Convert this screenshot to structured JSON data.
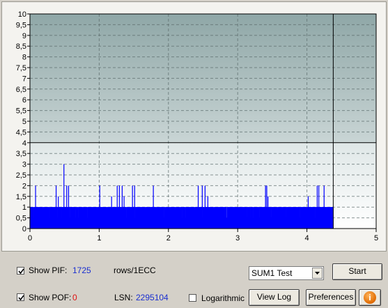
{
  "chart_data": {
    "type": "bar",
    "y_ticks": [
      "10",
      "9,5",
      "9",
      "8,5",
      "8",
      "7,5",
      "7",
      "6,5",
      "6",
      "5,5",
      "5",
      "4,5",
      "4",
      "3,5",
      "3",
      "2,5",
      "2",
      "1,5",
      "1",
      "0,5",
      "0"
    ],
    "x_ticks": [
      "0",
      "1",
      "2",
      "3",
      "4",
      "5"
    ],
    "xlim": [
      0,
      5
    ],
    "ylim": [
      0,
      10
    ],
    "threshold": 4,
    "cursor_x": 4.38,
    "data_end_x": 4.38,
    "grid": true,
    "series": [
      {
        "color": "#0000ff",
        "baseline": 1,
        "spikes": [
          {
            "x": 0.08,
            "y": 2
          },
          {
            "x": 0.38,
            "y": 2
          },
          {
            "x": 0.41,
            "y": 1.5
          },
          {
            "x": 0.49,
            "y": 3
          },
          {
            "x": 0.53,
            "y": 2
          },
          {
            "x": 0.56,
            "y": 2
          },
          {
            "x": 1.01,
            "y": 2
          },
          {
            "x": 1.18,
            "y": 1.5
          },
          {
            "x": 1.26,
            "y": 2
          },
          {
            "x": 1.29,
            "y": 2
          },
          {
            "x": 1.33,
            "y": 2
          },
          {
            "x": 1.36,
            "y": 1.5
          },
          {
            "x": 1.48,
            "y": 2
          },
          {
            "x": 1.51,
            "y": 2
          },
          {
            "x": 1.78,
            "y": 2
          },
          {
            "x": 2.43,
            "y": 2
          },
          {
            "x": 2.49,
            "y": 2
          },
          {
            "x": 2.53,
            "y": 2
          },
          {
            "x": 2.57,
            "y": 1.5
          },
          {
            "x": 3.4,
            "y": 2
          },
          {
            "x": 3.42,
            "y": 2
          },
          {
            "x": 3.44,
            "y": 1.5
          },
          {
            "x": 4.02,
            "y": 1.5
          },
          {
            "x": 4.15,
            "y": 2
          },
          {
            "x": 4.17,
            "y": 2
          },
          {
            "x": 4.25,
            "y": 2
          }
        ]
      }
    ]
  },
  "controls": {
    "show_pif_label": "Show PIF:",
    "pif_value": "1725",
    "pif_unit": "rows/1ECC",
    "show_pof_label": "Show POF:",
    "pof_value": "0",
    "lsn_label": "LSN:",
    "lsn_value": "2295104",
    "logarithmic_label": "Logarithmic",
    "test_select_value": "SUM1 Test",
    "start_label": "Start",
    "view_log_label": "View Log",
    "preferences_label": "Preferences",
    "info_glyph": "i"
  }
}
